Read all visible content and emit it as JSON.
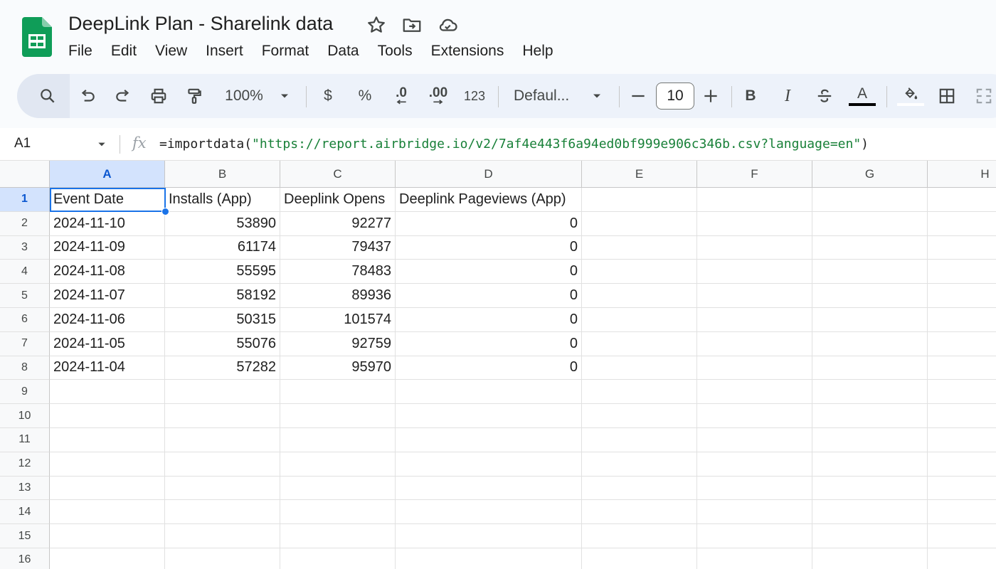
{
  "app": {
    "title": "DeepLink Plan - Sharelink data",
    "accent": "#0F9D58",
    "title_icons": [
      "star-icon",
      "move-to-folder-icon",
      "cloud-saved-icon"
    ]
  },
  "menu": [
    "File",
    "Edit",
    "View",
    "Insert",
    "Format",
    "Data",
    "Tools",
    "Extensions",
    "Help"
  ],
  "toolbar": {
    "zoom": "100%",
    "currency": "$",
    "percent": "%",
    "decrease_decimal": ".0",
    "increase_decimal": ".00",
    "number_format": "123",
    "font": "Defaul...",
    "font_size": "10",
    "bold": "B",
    "italic": "I",
    "text_color": "A",
    "icons": [
      "search-icon",
      "undo-icon",
      "redo-icon",
      "print-icon",
      "paint-format-icon",
      "zoom-dropdown-icon",
      "font-dropdown-icon",
      "decrease-font-size-icon",
      "increase-font-size-icon",
      "strikethrough-icon",
      "fill-color-icon",
      "borders-icon",
      "merge-cells-icon"
    ]
  },
  "formula_bar": {
    "cell_ref": "A1",
    "fx": "fx",
    "formula_prefix": "=importdata(",
    "formula_string": "\"https://report.airbridge.io/v2/7af4e443f6a94ed0bf999e906c346b.csv?language=en\"",
    "formula_suffix": ")"
  },
  "sheet": {
    "columns": [
      "A",
      "B",
      "C",
      "D",
      "E",
      "F",
      "G",
      "H"
    ],
    "row_numbers": [
      "1",
      "2",
      "3",
      "4",
      "5",
      "6",
      "7",
      "8",
      "9",
      "10",
      "11",
      "12",
      "13",
      "14",
      "15",
      "16"
    ],
    "selected_cell": "A1",
    "rows": [
      [
        "Event Date",
        "Installs (App)",
        "Deeplink Opens",
        "Deeplink Pageviews (App)"
      ],
      [
        "2024-11-10",
        "53890",
        "92277",
        "0"
      ],
      [
        "2024-11-09",
        "61174",
        "79437",
        "0"
      ],
      [
        "2024-11-08",
        "55595",
        "78483",
        "0"
      ],
      [
        "2024-11-07",
        "58192",
        "89936",
        "0"
      ],
      [
        "2024-11-06",
        "50315",
        "101574",
        "0"
      ],
      [
        "2024-11-05",
        "55076",
        "92759",
        "0"
      ],
      [
        "2024-11-04",
        "57282",
        "95970",
        "0"
      ]
    ]
  }
}
